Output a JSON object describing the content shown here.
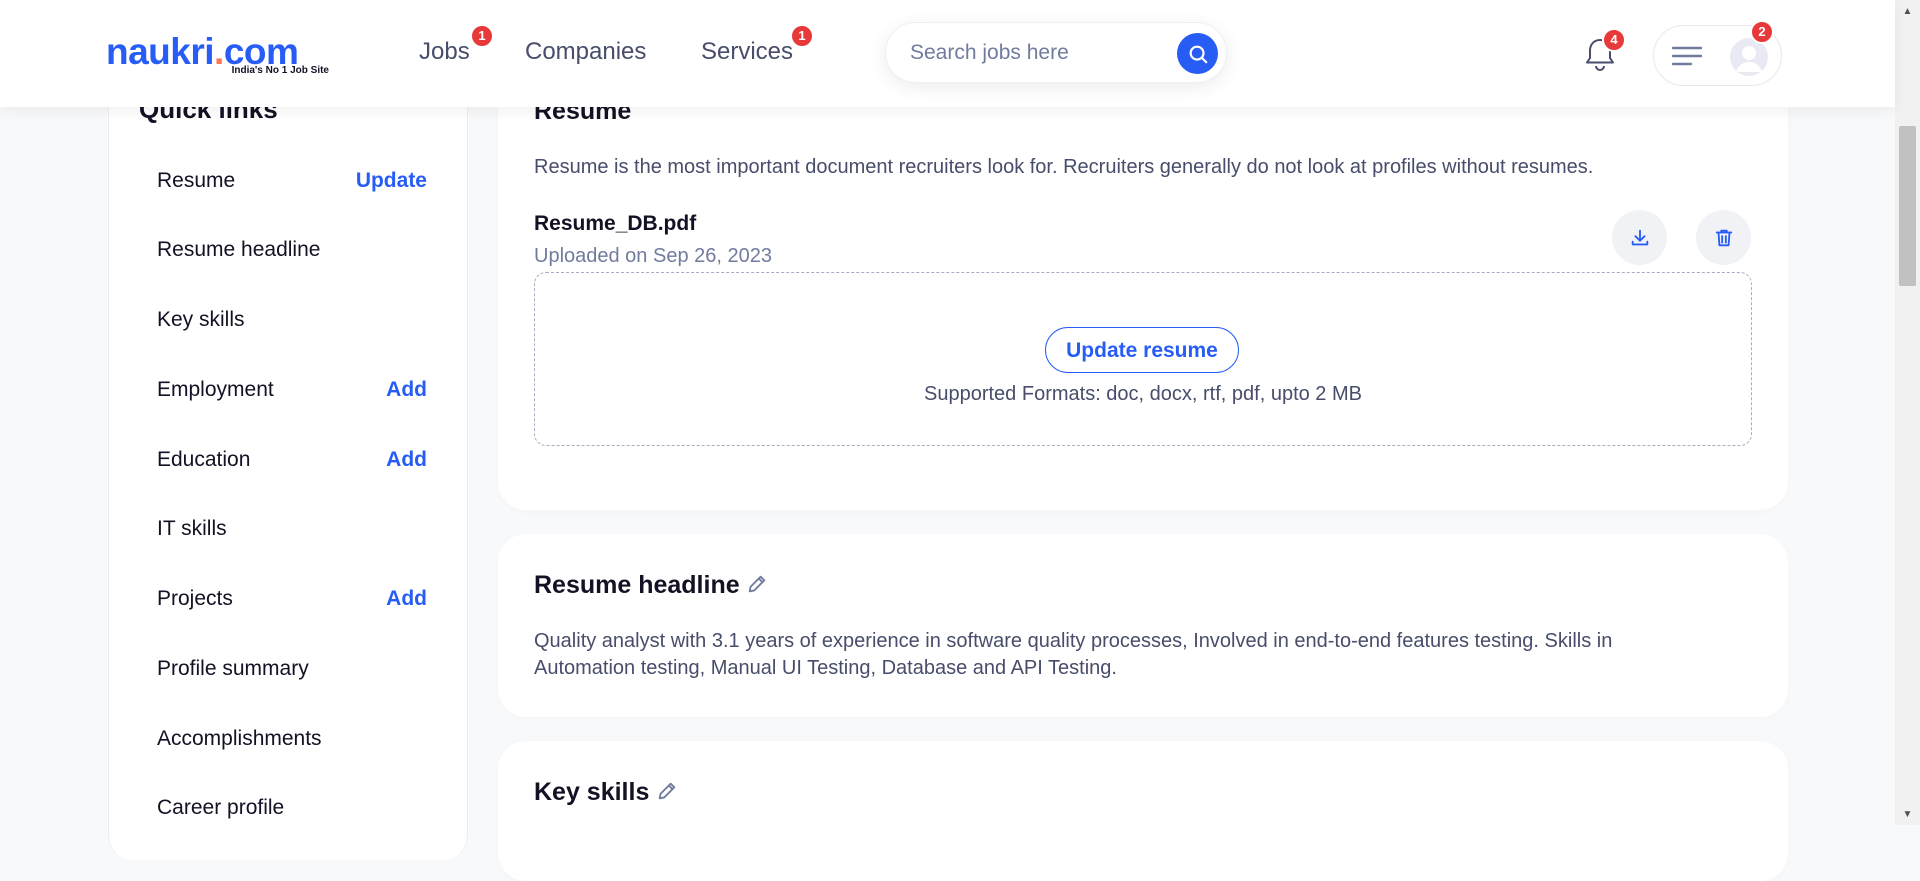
{
  "header": {
    "logo": {
      "name": "naukri",
      "dot": ".",
      "tld": "com",
      "tagline": "India's No 1 Job Site"
    },
    "nav": [
      {
        "label": "Jobs",
        "badge": "1"
      },
      {
        "label": "Companies",
        "badge": ""
      },
      {
        "label": "Services",
        "badge": "1"
      }
    ],
    "search": {
      "placeholder": "Search jobs here",
      "value": ""
    },
    "notifications": {
      "badge": "4",
      "icon": "bell-icon"
    },
    "menu": {
      "badge": "2",
      "icons": [
        "hamburger-icon",
        "avatar-icon"
      ]
    }
  },
  "sidebar": {
    "title": "Quick links",
    "items": [
      {
        "label": "Resume",
        "action": "Update"
      },
      {
        "label": "Resume headline",
        "action": ""
      },
      {
        "label": "Key skills",
        "action": ""
      },
      {
        "label": "Employment",
        "action": "Add"
      },
      {
        "label": "Education",
        "action": "Add"
      },
      {
        "label": "IT skills",
        "action": ""
      },
      {
        "label": "Projects",
        "action": "Add"
      },
      {
        "label": "Profile summary",
        "action": ""
      },
      {
        "label": "Accomplishments",
        "action": ""
      },
      {
        "label": "Career profile",
        "action": ""
      }
    ]
  },
  "resume": {
    "title": "Resume",
    "description": "Resume is the most important document recruiters look for. Recruiters generally do not look at profiles without resumes.",
    "file_name": "Resume_DB.pdf",
    "uploaded": "Uploaded on Sep 26, 2023",
    "update_button": "Update resume",
    "formats": "Supported Formats: doc, docx, rtf, pdf, upto 2 MB",
    "icons": [
      "download-icon",
      "trash-icon"
    ]
  },
  "headline": {
    "title": "Resume headline",
    "line1": "Quality analyst with 3.1 years of experience in software quality processes, Involved in end-to-end features testing. Skills in",
    "line2": "Automation testing, Manual UI Testing, Database and API Testing."
  },
  "key_skills": {
    "title": "Key skills"
  },
  "colors": {
    "brand_blue": "#275df5",
    "badge_red": "#e8393a",
    "text_dark": "#121224",
    "text_muted": "#474d6a"
  }
}
